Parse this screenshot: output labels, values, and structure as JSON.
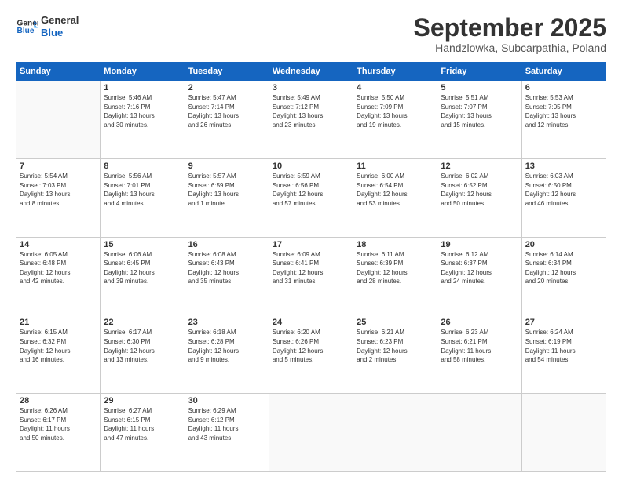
{
  "header": {
    "logo_line1": "General",
    "logo_line2": "Blue",
    "month_title": "September 2025",
    "location": "Handzlowka, Subcarpathia, Poland"
  },
  "days_of_week": [
    "Sunday",
    "Monday",
    "Tuesday",
    "Wednesday",
    "Thursday",
    "Friday",
    "Saturday"
  ],
  "weeks": [
    [
      {
        "day": "",
        "info": ""
      },
      {
        "day": "1",
        "info": "Sunrise: 5:46 AM\nSunset: 7:16 PM\nDaylight: 13 hours\nand 30 minutes."
      },
      {
        "day": "2",
        "info": "Sunrise: 5:47 AM\nSunset: 7:14 PM\nDaylight: 13 hours\nand 26 minutes."
      },
      {
        "day": "3",
        "info": "Sunrise: 5:49 AM\nSunset: 7:12 PM\nDaylight: 13 hours\nand 23 minutes."
      },
      {
        "day": "4",
        "info": "Sunrise: 5:50 AM\nSunset: 7:09 PM\nDaylight: 13 hours\nand 19 minutes."
      },
      {
        "day": "5",
        "info": "Sunrise: 5:51 AM\nSunset: 7:07 PM\nDaylight: 13 hours\nand 15 minutes."
      },
      {
        "day": "6",
        "info": "Sunrise: 5:53 AM\nSunset: 7:05 PM\nDaylight: 13 hours\nand 12 minutes."
      }
    ],
    [
      {
        "day": "7",
        "info": "Sunrise: 5:54 AM\nSunset: 7:03 PM\nDaylight: 13 hours\nand 8 minutes."
      },
      {
        "day": "8",
        "info": "Sunrise: 5:56 AM\nSunset: 7:01 PM\nDaylight: 13 hours\nand 4 minutes."
      },
      {
        "day": "9",
        "info": "Sunrise: 5:57 AM\nSunset: 6:59 PM\nDaylight: 13 hours\nand 1 minute."
      },
      {
        "day": "10",
        "info": "Sunrise: 5:59 AM\nSunset: 6:56 PM\nDaylight: 12 hours\nand 57 minutes."
      },
      {
        "day": "11",
        "info": "Sunrise: 6:00 AM\nSunset: 6:54 PM\nDaylight: 12 hours\nand 53 minutes."
      },
      {
        "day": "12",
        "info": "Sunrise: 6:02 AM\nSunset: 6:52 PM\nDaylight: 12 hours\nand 50 minutes."
      },
      {
        "day": "13",
        "info": "Sunrise: 6:03 AM\nSunset: 6:50 PM\nDaylight: 12 hours\nand 46 minutes."
      }
    ],
    [
      {
        "day": "14",
        "info": "Sunrise: 6:05 AM\nSunset: 6:48 PM\nDaylight: 12 hours\nand 42 minutes."
      },
      {
        "day": "15",
        "info": "Sunrise: 6:06 AM\nSunset: 6:45 PM\nDaylight: 12 hours\nand 39 minutes."
      },
      {
        "day": "16",
        "info": "Sunrise: 6:08 AM\nSunset: 6:43 PM\nDaylight: 12 hours\nand 35 minutes."
      },
      {
        "day": "17",
        "info": "Sunrise: 6:09 AM\nSunset: 6:41 PM\nDaylight: 12 hours\nand 31 minutes."
      },
      {
        "day": "18",
        "info": "Sunrise: 6:11 AM\nSunset: 6:39 PM\nDaylight: 12 hours\nand 28 minutes."
      },
      {
        "day": "19",
        "info": "Sunrise: 6:12 AM\nSunset: 6:37 PM\nDaylight: 12 hours\nand 24 minutes."
      },
      {
        "day": "20",
        "info": "Sunrise: 6:14 AM\nSunset: 6:34 PM\nDaylight: 12 hours\nand 20 minutes."
      }
    ],
    [
      {
        "day": "21",
        "info": "Sunrise: 6:15 AM\nSunset: 6:32 PM\nDaylight: 12 hours\nand 16 minutes."
      },
      {
        "day": "22",
        "info": "Sunrise: 6:17 AM\nSunset: 6:30 PM\nDaylight: 12 hours\nand 13 minutes."
      },
      {
        "day": "23",
        "info": "Sunrise: 6:18 AM\nSunset: 6:28 PM\nDaylight: 12 hours\nand 9 minutes."
      },
      {
        "day": "24",
        "info": "Sunrise: 6:20 AM\nSunset: 6:26 PM\nDaylight: 12 hours\nand 5 minutes."
      },
      {
        "day": "25",
        "info": "Sunrise: 6:21 AM\nSunset: 6:23 PM\nDaylight: 12 hours\nand 2 minutes."
      },
      {
        "day": "26",
        "info": "Sunrise: 6:23 AM\nSunset: 6:21 PM\nDaylight: 11 hours\nand 58 minutes."
      },
      {
        "day": "27",
        "info": "Sunrise: 6:24 AM\nSunset: 6:19 PM\nDaylight: 11 hours\nand 54 minutes."
      }
    ],
    [
      {
        "day": "28",
        "info": "Sunrise: 6:26 AM\nSunset: 6:17 PM\nDaylight: 11 hours\nand 50 minutes."
      },
      {
        "day": "29",
        "info": "Sunrise: 6:27 AM\nSunset: 6:15 PM\nDaylight: 11 hours\nand 47 minutes."
      },
      {
        "day": "30",
        "info": "Sunrise: 6:29 AM\nSunset: 6:12 PM\nDaylight: 11 hours\nand 43 minutes."
      },
      {
        "day": "",
        "info": ""
      },
      {
        "day": "",
        "info": ""
      },
      {
        "day": "",
        "info": ""
      },
      {
        "day": "",
        "info": ""
      }
    ]
  ]
}
